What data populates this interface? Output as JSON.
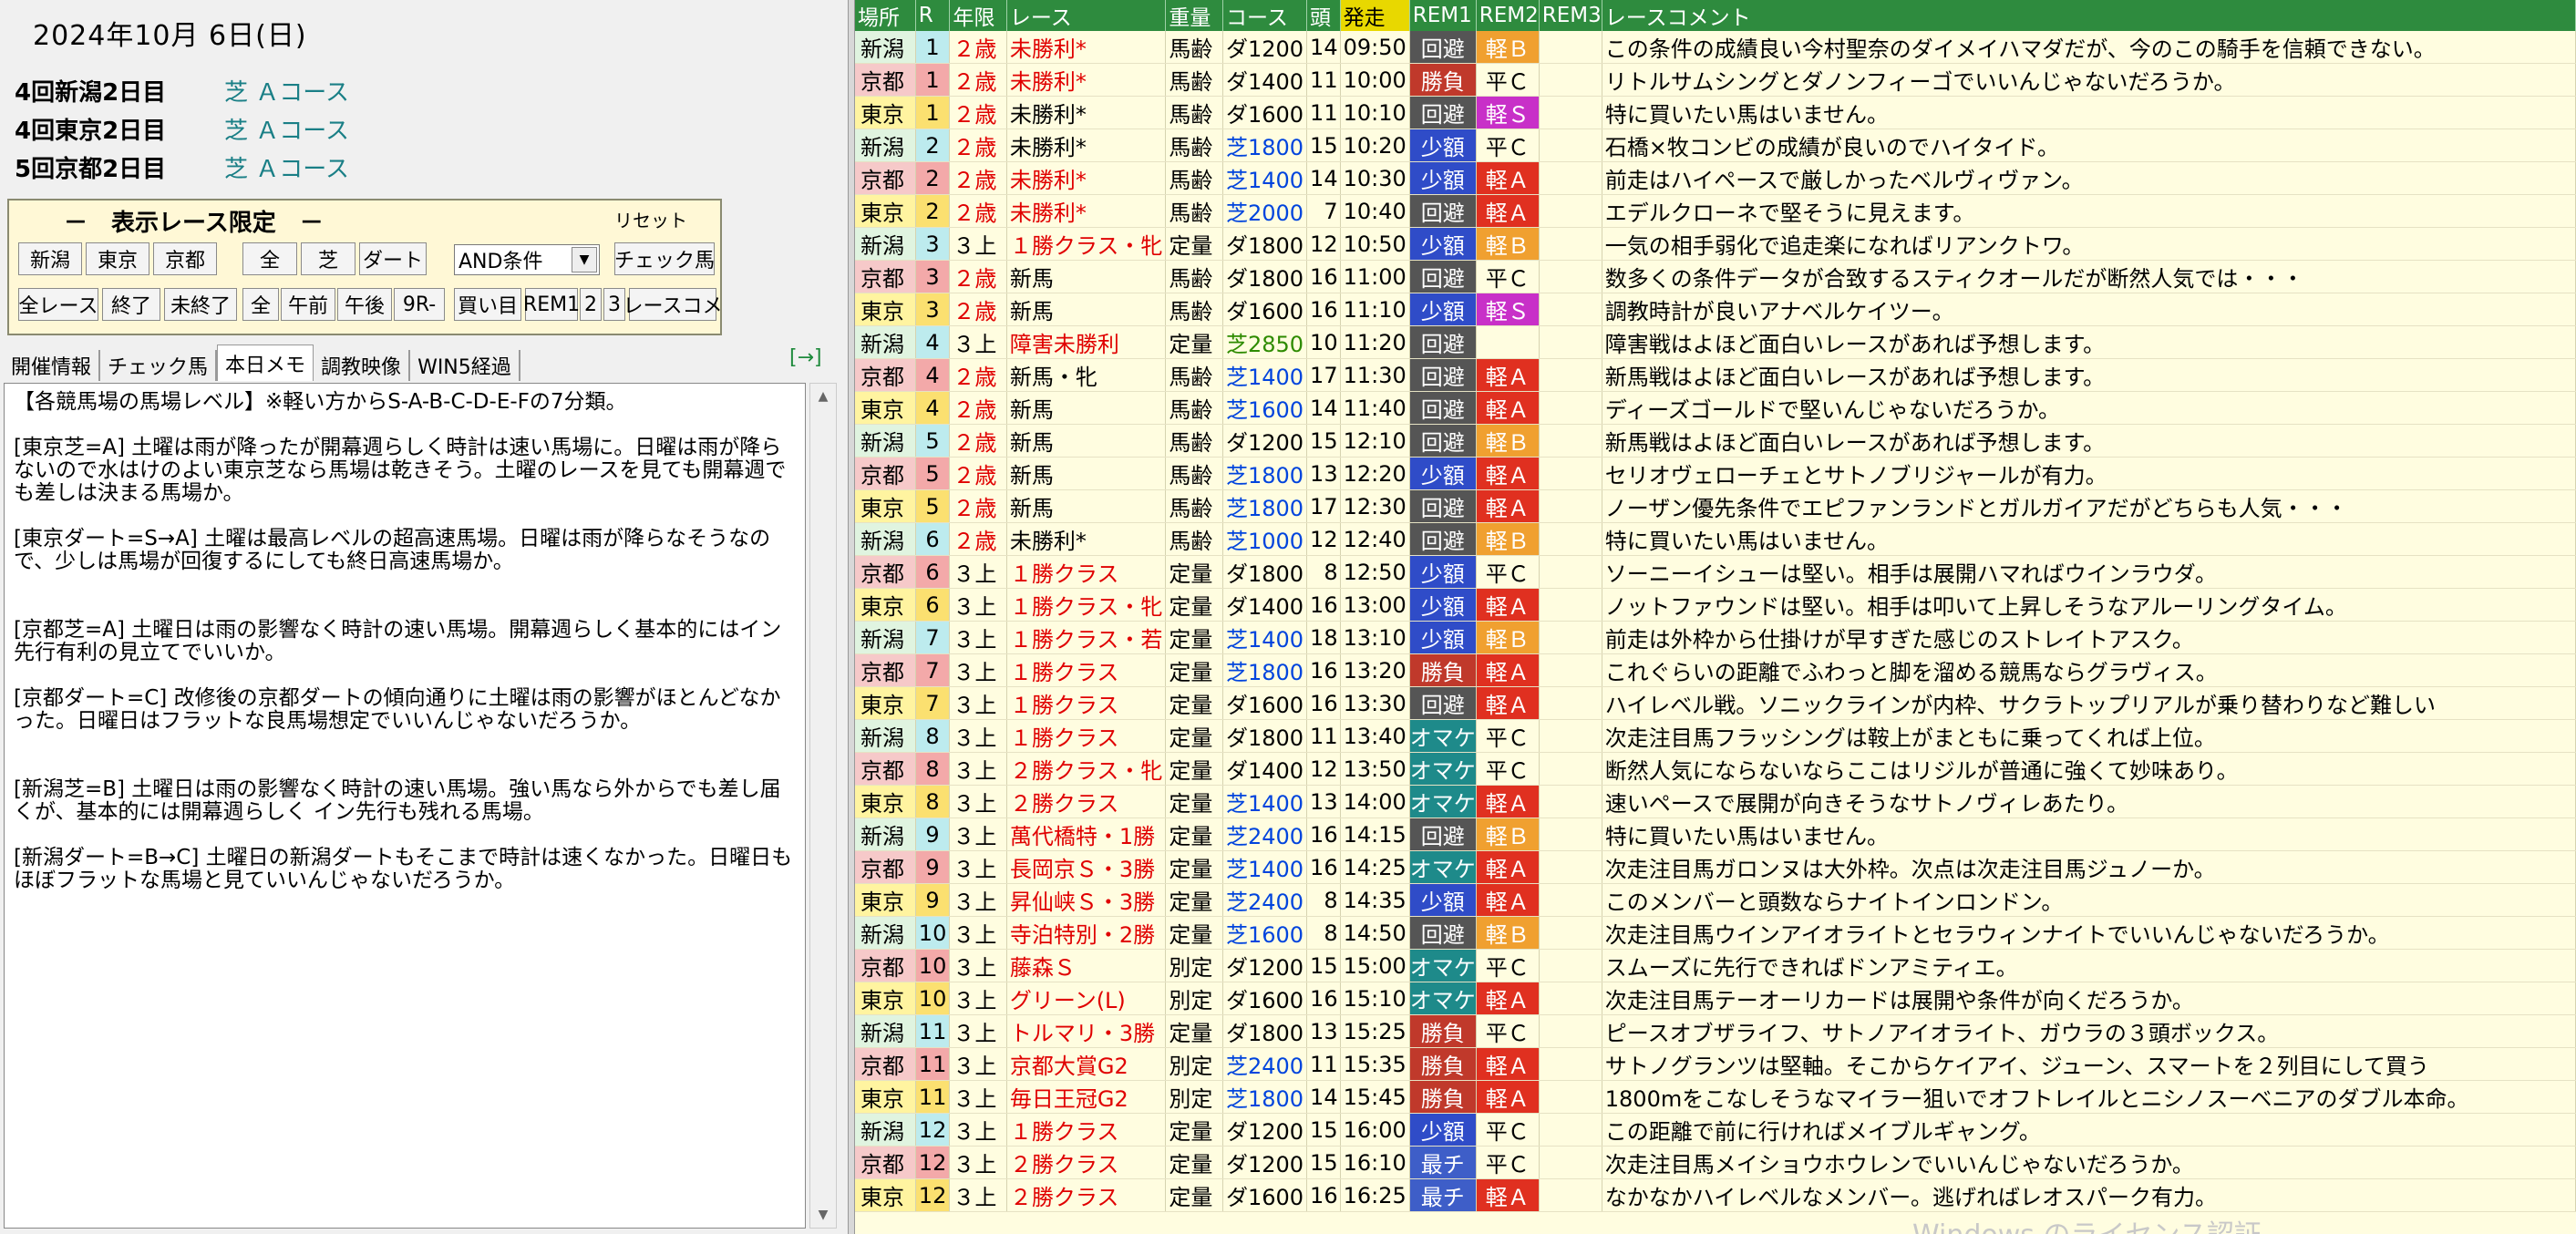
{
  "left": {
    "date": "2024年10月 6日(日)",
    "venues": [
      {
        "name": "4回新潟2日目",
        "course": "芝 Ａコース"
      },
      {
        "name": "4回東京2日目",
        "course": "芝 Ａコース"
      },
      {
        "name": "5回京都2日目",
        "course": "芝 Ａコース"
      }
    ],
    "filter": {
      "title": "－　表示レース限定　－",
      "reset": "リセット",
      "btn_niigata": "新潟",
      "btn_tokyo": "東京",
      "btn_kyoto": "京都",
      "btn_all": "全",
      "btn_turf": "芝",
      "btn_dirt": "ダート",
      "cond_select": "AND条件",
      "btn_check_horse": "チェック馬",
      "btn_all_races": "全レース",
      "btn_finished": "終了",
      "btn_unfinished": "未終了",
      "btn_all2": "全",
      "btn_am": "午前",
      "btn_pm": "午後",
      "btn_9r": "9R-",
      "btn_buy": "買い目",
      "btn_rem1": "REM1",
      "btn_rem2": "2",
      "btn_rem3": "3",
      "btn_race_comment": "レースコメ"
    },
    "tabs": [
      "開催情報",
      "チェック馬",
      "本日メモ",
      "調教映像",
      "WIN5経過"
    ],
    "tab_arrow": "[→]",
    "memo": "【各競馬場の馬場レベル】※軽い方からS-A-B-C-D-E-Fの7分類。\n\n[東京芝=A] 土曜は雨が降ったが開幕週らしく時計は速い馬場に。日曜は雨が降らないので水はけのよい東京芝なら馬場は乾きそう。土曜のレースを見ても開幕週でも差しは決まる馬場か。\n\n[東京ダート=S→A] 土曜は最高レベルの超高速馬場。日曜は雨が降らなそうなので、少しは馬場が回復するにしても終日高速馬場か。\n\n\n[京都芝=A] 土曜日は雨の影響なく時計の速い馬場。開幕週らしく基本的にはイン先行有利の見立てでいいか。\n\n[京都ダート=C] 改修後の京都ダートの傾向通りに土曜は雨の影響がほとんどなかった。日曜日はフラットな良馬場想定でいいんじゃないだろうか。\n\n\n[新潟芝=B] 土曜日は雨の影響なく時計の速い馬場。強い馬なら外からでも差し届くが、基本的には開幕週らしく イン先行も残れる馬場。\n\n[新潟ダート=B→C] 土曜日の新潟ダートもそこまで時計は速くなかった。日曜日もほぼフラットな馬場と見ていいんじゃないだろうか。"
  },
  "table": {
    "headers": [
      "場所",
      "R",
      "年限",
      "レース",
      "重量",
      "コース",
      "頭",
      "発走",
      "REM1",
      "REM2",
      "REM3",
      "レースコメント"
    ],
    "rows": [
      [
        "新潟",
        "1",
        "２歳",
        "未勝利*",
        "馬齢",
        "ダ1200",
        "14",
        "09:50",
        "回避",
        "軽Ｂ",
        "",
        "この条件の成績良い今村聖奈のダイメイハマダだが、今のこの騎手を信頼できない。"
      ],
      [
        "京都",
        "1",
        "２歳",
        "未勝利*",
        "馬齢",
        "ダ1400",
        "11",
        "10:00",
        "勝負",
        "平Ｃ",
        "",
        "リトルサムシングとダノンフィーゴでいいんじゃないだろうか。"
      ],
      [
        "東京",
        "1",
        "２歳",
        "未勝利*",
        "馬齢",
        "ダ1600",
        "11",
        "10:10",
        "回避",
        "軽Ｓ",
        "",
        "特に買いたい馬はいません。"
      ],
      [
        "新潟",
        "2",
        "２歳",
        "未勝利*",
        "馬齢",
        "芝1800",
        "15",
        "10:20",
        "少額",
        "平Ｃ",
        "",
        "石橋×牧コンビの成績が良いのでハイタイド。"
      ],
      [
        "京都",
        "2",
        "２歳",
        "未勝利*",
        "馬齢",
        "芝1400",
        "14",
        "10:30",
        "少額",
        "軽Ａ",
        "",
        "前走はハイペースで厳しかったベルヴィヴァン。"
      ],
      [
        "東京",
        "2",
        "２歳",
        "未勝利*",
        "馬齢",
        "芝2000",
        "7",
        "10:40",
        "回避",
        "軽Ａ",
        "",
        "エデルクローネで堅そうに見えます。"
      ],
      [
        "新潟",
        "3",
        "３上",
        "１勝クラス・牝",
        "定量",
        "ダ1800",
        "12",
        "10:50",
        "少額",
        "軽Ｂ",
        "",
        "一気の相手弱化で追走楽になればリアンクトワ。"
      ],
      [
        "京都",
        "3",
        "２歳",
        "新馬",
        "馬齢",
        "ダ1800",
        "16",
        "11:00",
        "回避",
        "平Ｃ",
        "",
        "数多くの条件データが合致するスティクオールだが断然人気では・・・"
      ],
      [
        "東京",
        "3",
        "２歳",
        "新馬",
        "馬齢",
        "ダ1600",
        "16",
        "11:10",
        "少額",
        "軽Ｓ",
        "",
        "調教時計が良いアナベルケイツー。"
      ],
      [
        "新潟",
        "4",
        "３上",
        "障害未勝利",
        "定量",
        "芝2850",
        "10",
        "11:20",
        "回避",
        "",
        "",
        "障害戦はよほど面白いレースがあれば予想します。"
      ],
      [
        "京都",
        "4",
        "２歳",
        "新馬・牝",
        "馬齢",
        "芝1400",
        "17",
        "11:30",
        "回避",
        "軽Ａ",
        "",
        "新馬戦はよほど面白いレースがあれば予想します。"
      ],
      [
        "東京",
        "4",
        "２歳",
        "新馬",
        "馬齢",
        "芝1600",
        "14",
        "11:40",
        "回避",
        "軽Ａ",
        "",
        "ディーズゴールドで堅いんじゃないだろうか。"
      ],
      [
        "新潟",
        "5",
        "２歳",
        "新馬",
        "馬齢",
        "ダ1200",
        "15",
        "12:10",
        "回避",
        "軽Ｂ",
        "",
        "新馬戦はよほど面白いレースがあれば予想します。"
      ],
      [
        "京都",
        "5",
        "２歳",
        "新馬",
        "馬齢",
        "芝1800",
        "13",
        "12:20",
        "少額",
        "軽Ａ",
        "",
        "セリオヴェローチェとサトノブリジャールが有力。"
      ],
      [
        "東京",
        "5",
        "２歳",
        "新馬",
        "馬齢",
        "芝1800",
        "17",
        "12:30",
        "回避",
        "軽Ａ",
        "",
        "ノーザン優先条件でエピファンランドとガルガイアだがどちらも人気・・・"
      ],
      [
        "新潟",
        "6",
        "２歳",
        "未勝利*",
        "馬齢",
        "芝1000",
        "12",
        "12:40",
        "回避",
        "軽Ｂ",
        "",
        "特に買いたい馬はいません。"
      ],
      [
        "京都",
        "6",
        "３上",
        "１勝クラス",
        "定量",
        "ダ1800",
        "8",
        "12:50",
        "少額",
        "平Ｃ",
        "",
        "ソーニーイシューは堅い。相手は展開ハマればウインラウダ。"
      ],
      [
        "東京",
        "6",
        "３上",
        "１勝クラス・牝",
        "定量",
        "ダ1400",
        "16",
        "13:00",
        "少額",
        "軽Ａ",
        "",
        "ノットファウンドは堅い。相手は叩いて上昇しそうなアルーリングタイム。"
      ],
      [
        "新潟",
        "7",
        "３上",
        "１勝クラス・若",
        "定量",
        "芝1400",
        "18",
        "13:10",
        "少額",
        "軽Ｂ",
        "",
        "前走は外枠から仕掛けが早すぎた感じのストレイトアスク。"
      ],
      [
        "京都",
        "7",
        "３上",
        "１勝クラス",
        "定量",
        "芝1800",
        "16",
        "13:20",
        "勝負",
        "軽Ａ",
        "",
        "これぐらいの距離でふわっと脚を溜める競馬ならグラヴィス。"
      ],
      [
        "東京",
        "7",
        "３上",
        "１勝クラス",
        "定量",
        "ダ1600",
        "16",
        "13:30",
        "回避",
        "軽Ａ",
        "",
        "ハイレベル戦。ソニックラインが内枠、サクラトップリアルが乗り替わりなど難しい"
      ],
      [
        "新潟",
        "8",
        "３上",
        "１勝クラス",
        "定量",
        "ダ1800",
        "11",
        "13:40",
        "オマケ",
        "平Ｃ",
        "",
        "次走注目馬フラッシングは鞍上がまともに乗ってくれば上位。"
      ],
      [
        "京都",
        "8",
        "３上",
        "２勝クラス・牝",
        "定量",
        "ダ1400",
        "12",
        "13:50",
        "オマケ",
        "平Ｃ",
        "",
        "断然人気にならないならここはリジルが普通に強くて妙味あり。"
      ],
      [
        "東京",
        "8",
        "３上",
        "２勝クラス",
        "定量",
        "芝1400",
        "13",
        "14:00",
        "オマケ",
        "軽Ａ",
        "",
        "速いペースで展開が向きそうなサトノヴィレあたり。"
      ],
      [
        "新潟",
        "9",
        "３上",
        "萬代橋特・1勝",
        "定量",
        "芝2400",
        "16",
        "14:15",
        "回避",
        "軽Ｂ",
        "",
        "特に買いたい馬はいません。"
      ],
      [
        "京都",
        "9",
        "３上",
        "長岡京Ｓ・3勝",
        "定量",
        "芝1400",
        "16",
        "14:25",
        "オマケ",
        "軽Ａ",
        "",
        "次走注目馬ガロンヌは大外枠。次点は次走注目馬ジュノーか。"
      ],
      [
        "東京",
        "9",
        "３上",
        "昇仙峡Ｓ・3勝",
        "定量",
        "芝2400",
        "8",
        "14:35",
        "少額",
        "軽Ａ",
        "",
        "このメンバーと頭数ならナイトインロンドン。"
      ],
      [
        "新潟",
        "10",
        "３上",
        "寺泊特別・2勝",
        "定量",
        "芝1600",
        "8",
        "14:50",
        "回避",
        "軽Ｂ",
        "",
        "次走注目馬ウインアイオライトとセラウィンナイトでいいんじゃないだろうか。"
      ],
      [
        "京都",
        "10",
        "３上",
        "藤森Ｓ",
        "別定",
        "ダ1200",
        "15",
        "15:00",
        "オマケ",
        "平Ｃ",
        "",
        "スムーズに先行できればドンアミティエ。"
      ],
      [
        "東京",
        "10",
        "３上",
        "グリーン(L)",
        "別定",
        "ダ1600",
        "16",
        "15:10",
        "オマケ",
        "軽Ａ",
        "",
        "次走注目馬テーオーリカードは展開や条件が向くだろうか。"
      ],
      [
        "新潟",
        "11",
        "３上",
        "トルマリ・3勝",
        "定量",
        "ダ1800",
        "13",
        "15:25",
        "勝負",
        "平Ｃ",
        "",
        "ピースオブザライフ、サトノアイオライト、ガウラの３頭ボックス。"
      ],
      [
        "京都",
        "11",
        "３上",
        "京都大賞G2",
        "別定",
        "芝2400",
        "11",
        "15:35",
        "勝負",
        "軽Ａ",
        "",
        "サトノグランツは堅軸。そこからケイアイ、ジューン、スマートを２列目にして買う"
      ],
      [
        "東京",
        "11",
        "３上",
        "毎日王冠G2",
        "別定",
        "芝1800",
        "14",
        "15:45",
        "勝負",
        "軽Ａ",
        "",
        "1800mをこなしそうなマイラー狙いでオフトレイルとニシノスーベニアのダブル本命。"
      ],
      [
        "新潟",
        "12",
        "３上",
        "１勝クラス",
        "定量",
        "ダ1200",
        "15",
        "16:00",
        "少額",
        "平Ｃ",
        "",
        "この距離で前に行ければメイブルギャング。"
      ],
      [
        "京都",
        "12",
        "３上",
        "２勝クラス",
        "定量",
        "ダ1200",
        "15",
        "16:10",
        "最チ",
        "平Ｃ",
        "",
        "次走注目馬メイショウホウレンでいいんじゃないだろうか。"
      ],
      [
        "東京",
        "12",
        "３上",
        "２勝クラス",
        "定量",
        "ダ1600",
        "16",
        "16:25",
        "最チ",
        "軽Ａ",
        "",
        "なかなかハイレベルなメンバー。逃げればレオスパーク有力。"
      ]
    ]
  },
  "watermark": "Windows のライセンス認証",
  "colors": {
    "header_bg": "#2e8b3e",
    "rem1_kaihi": "#555555",
    "rem1_shogaku": "#2f4cc8",
    "rem1_shobu": "#c0392b",
    "rem1_omake": "#1e8a8a",
    "rem1_saichi": "#3e5ec8",
    "rem2_B": "#f0a030",
    "rem2_S": "#c830c8",
    "rem2_A": "#e03020",
    "rem2_C": "#fffde0"
  }
}
